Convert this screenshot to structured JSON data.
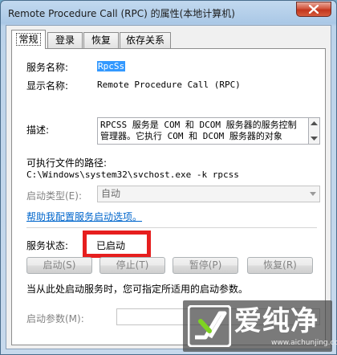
{
  "window": {
    "title": "Remote Procedure Call (RPC) 的属性(本地计算机)"
  },
  "tabs": [
    {
      "label": "常规"
    },
    {
      "label": "登录"
    },
    {
      "label": "恢复"
    },
    {
      "label": "依存关系"
    }
  ],
  "general": {
    "service_name_label": "服务名称:",
    "service_name_value": "RpcSs",
    "display_name_label": "显示名称:",
    "display_name_value": "Remote Procedure Call (RPC)",
    "description_label": "描述:",
    "description_line1": "RPCSS 服务是 COM 和 DCOM 服务器的服务控制",
    "description_line2": "管理器。它执行 COM 和 DCOM 服务器的对象",
    "exe_path_label": "可执行文件的路径:",
    "exe_path_value": "C:\\Windows\\system32\\svchost.exe -k rpcss",
    "startup_type_label": "启动类型(E):",
    "startup_type_value": "自动",
    "help_link": "帮助我配置服务启动选项。",
    "status_label": "服务状态:",
    "status_value": "已启动",
    "buttons": {
      "start": "启动(S)",
      "stop": "停止(T)",
      "pause": "暂停(P)",
      "resume": "恢复(R)"
    },
    "hint": "当从此处启动服务时，您可指定所适用的启动参数。",
    "start_params_label": "启动参数(M):",
    "start_params_value": ""
  },
  "watermark": {
    "text": "爱纯净",
    "url": "www.aichunjing.com"
  },
  "colors": {
    "highlight": "#e61e1e",
    "link": "#0066cc",
    "selection": "#3399ff"
  }
}
